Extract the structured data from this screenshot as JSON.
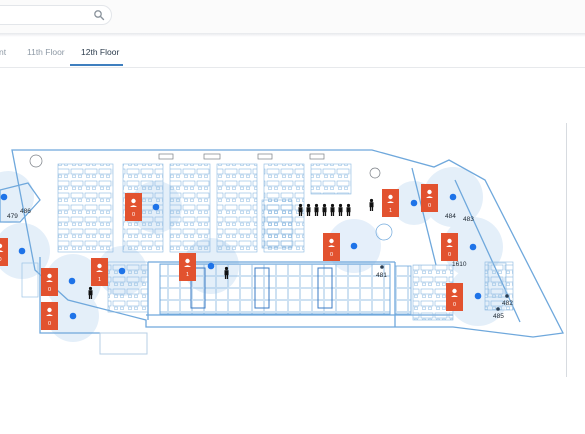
{
  "search": {
    "value": "",
    "icon": "search-icon"
  },
  "tabs": [
    {
      "label": "nt",
      "active": false
    },
    {
      "label": "11th Floor",
      "active": false
    },
    {
      "label": "12th Floor",
      "active": true
    }
  ],
  "colors": {
    "marker": "#e2522f",
    "dot": "#1e73e8",
    "halo": "#dbe9f8",
    "walls": "#6fa8dc"
  },
  "map": {
    "room_labels": [
      "486",
      "479",
      "484",
      "483",
      "481",
      "1610",
      "482",
      "485"
    ],
    "occupancy_markers": [
      {
        "count": "0"
      },
      {
        "count": "1"
      },
      {
        "count": "0"
      },
      {
        "count": "0"
      },
      {
        "count": "1"
      },
      {
        "count": "0"
      },
      {
        "count": "0"
      },
      {
        "count": "1"
      },
      {
        "count": "0"
      },
      {
        "count": "0"
      }
    ]
  }
}
